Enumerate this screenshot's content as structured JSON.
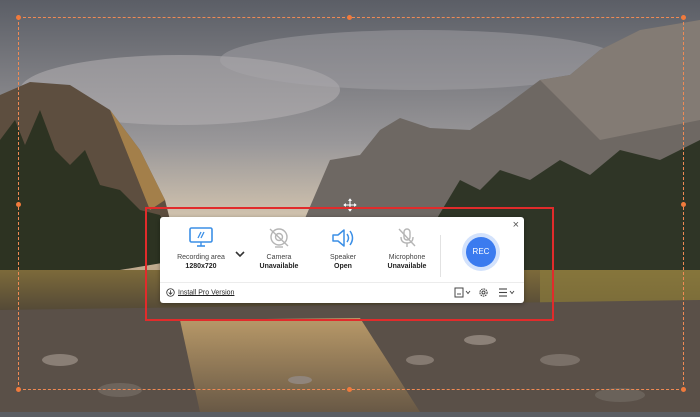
{
  "recorder": {
    "close_glyph": "×",
    "tools": [
      {
        "label": "Recording area",
        "value": "1280x720",
        "icon": "monitor-icon"
      },
      {
        "label": "Camera",
        "value": "Unavailable",
        "icon": "camera-off-icon"
      },
      {
        "label": "Speaker",
        "value": "Open",
        "icon": "speaker-icon"
      },
      {
        "label": "Microphone",
        "value": "Unavailable",
        "icon": "microphone-off-icon"
      }
    ],
    "rec_label": "REC",
    "install_label": "Install Pro Version",
    "footer_icons": [
      "video-history-icon",
      "settings-icon",
      "menu-icon"
    ],
    "colors": {
      "accent": "#3b7bef",
      "highlight": "#e12b2b",
      "frame": "#f08a54"
    }
  }
}
